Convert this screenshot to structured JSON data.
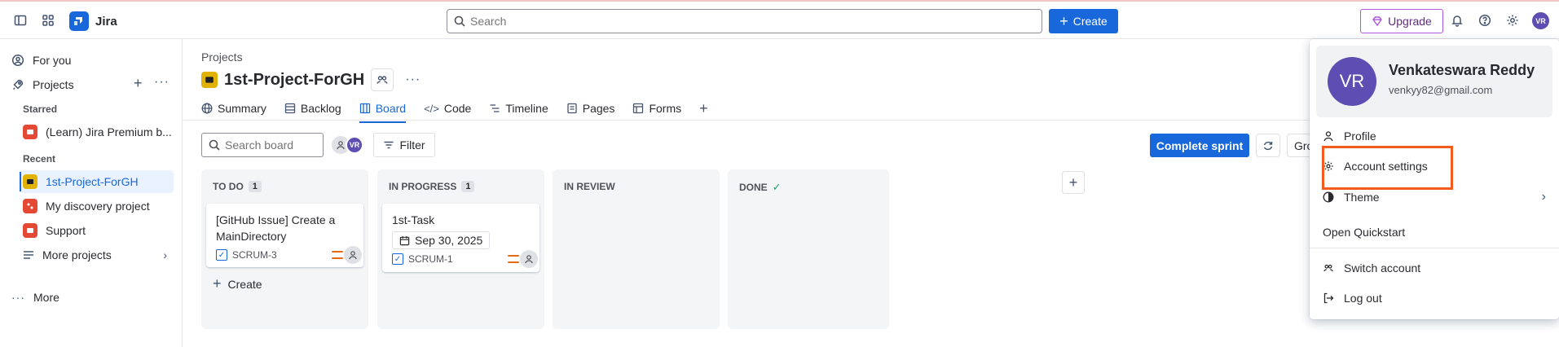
{
  "topbar": {
    "app_name": "Jira",
    "search_placeholder": "Search",
    "create_label": "Create",
    "upgrade_label": "Upgrade",
    "user_initials": "VR"
  },
  "sidebar": {
    "for_you": "For you",
    "projects": "Projects",
    "starred_label": "Starred",
    "starred_item": "(Learn) Jira Premium b...",
    "recent_label": "Recent",
    "recent_items": [
      "1st-Project-ForGH",
      "My discovery project",
      "Support"
    ],
    "more_projects": "More projects",
    "more": "More"
  },
  "project": {
    "breadcrumb": "Projects",
    "title": "1st-Project-ForGH",
    "tabs": [
      "Summary",
      "Backlog",
      "Board",
      "Code",
      "Timeline",
      "Pages",
      "Forms"
    ],
    "active_tab": "Board"
  },
  "board": {
    "search_placeholder": "Search board",
    "filter_label": "Filter",
    "complete_sprint_label": "Complete sprint",
    "group_label": "Gro",
    "columns": [
      {
        "name": "TO DO",
        "count": "1"
      },
      {
        "name": "IN PROGRESS",
        "count": "1"
      },
      {
        "name": "IN REVIEW",
        "count": ""
      },
      {
        "name": "DONE",
        "count": ""
      }
    ],
    "card1": {
      "title": "[GitHub Issue] Create a MainDirectory",
      "key": "SCRUM-3"
    },
    "card2": {
      "title": "1st-Task",
      "date": "Sep 30, 2025",
      "key": "SCRUM-1"
    },
    "create_label": "Create"
  },
  "account_menu": {
    "initials": "VR",
    "name": "Venkateswara Reddy",
    "email": "venkyy82@gmail.com",
    "profile": "Profile",
    "account_settings": "Account settings",
    "theme": "Theme",
    "open_quickstart": "Open Quickstart",
    "switch_account": "Switch account",
    "log_out": "Log out"
  },
  "colors": {
    "brand": "#1868db",
    "avatar": "#5e4db2",
    "highlight": "#f55a1e",
    "upgrade": "#af59e1"
  }
}
